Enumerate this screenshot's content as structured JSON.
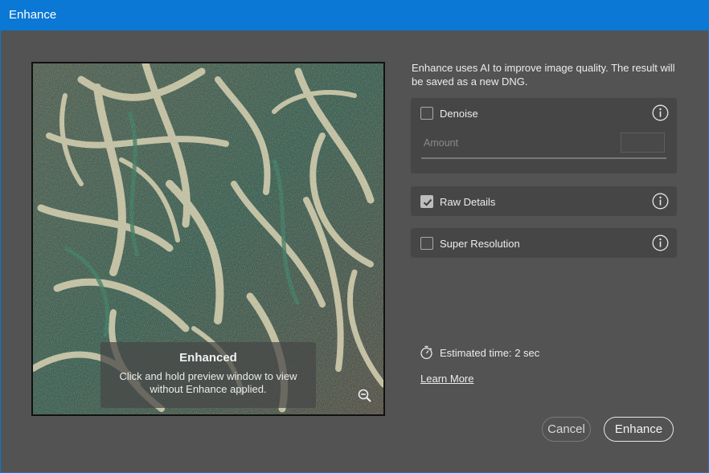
{
  "window": {
    "title": "Enhance"
  },
  "preview": {
    "overlay_title": "Enhanced",
    "overlay_text": "Click and hold preview window to view without Enhance applied.",
    "zoom_icon": "zoom-out-icon"
  },
  "description": "Enhance uses AI to improve image quality. The result will be saved as a new DNG.",
  "options": {
    "denoise": {
      "label": "Denoise",
      "checked": false,
      "amount_label": "Amount",
      "amount_value": ""
    },
    "raw_details": {
      "label": "Raw Details",
      "checked": true
    },
    "super_resolution": {
      "label": "Super Resolution",
      "checked": false
    }
  },
  "estimate": {
    "text": "Estimated time: 2 sec",
    "icon": "stopwatch-icon"
  },
  "learn_more": "Learn More",
  "buttons": {
    "cancel": "Cancel",
    "enhance": "Enhance"
  },
  "colors": {
    "titlebar": "#0a78d4",
    "background": "#535353",
    "panel": "#464646"
  }
}
